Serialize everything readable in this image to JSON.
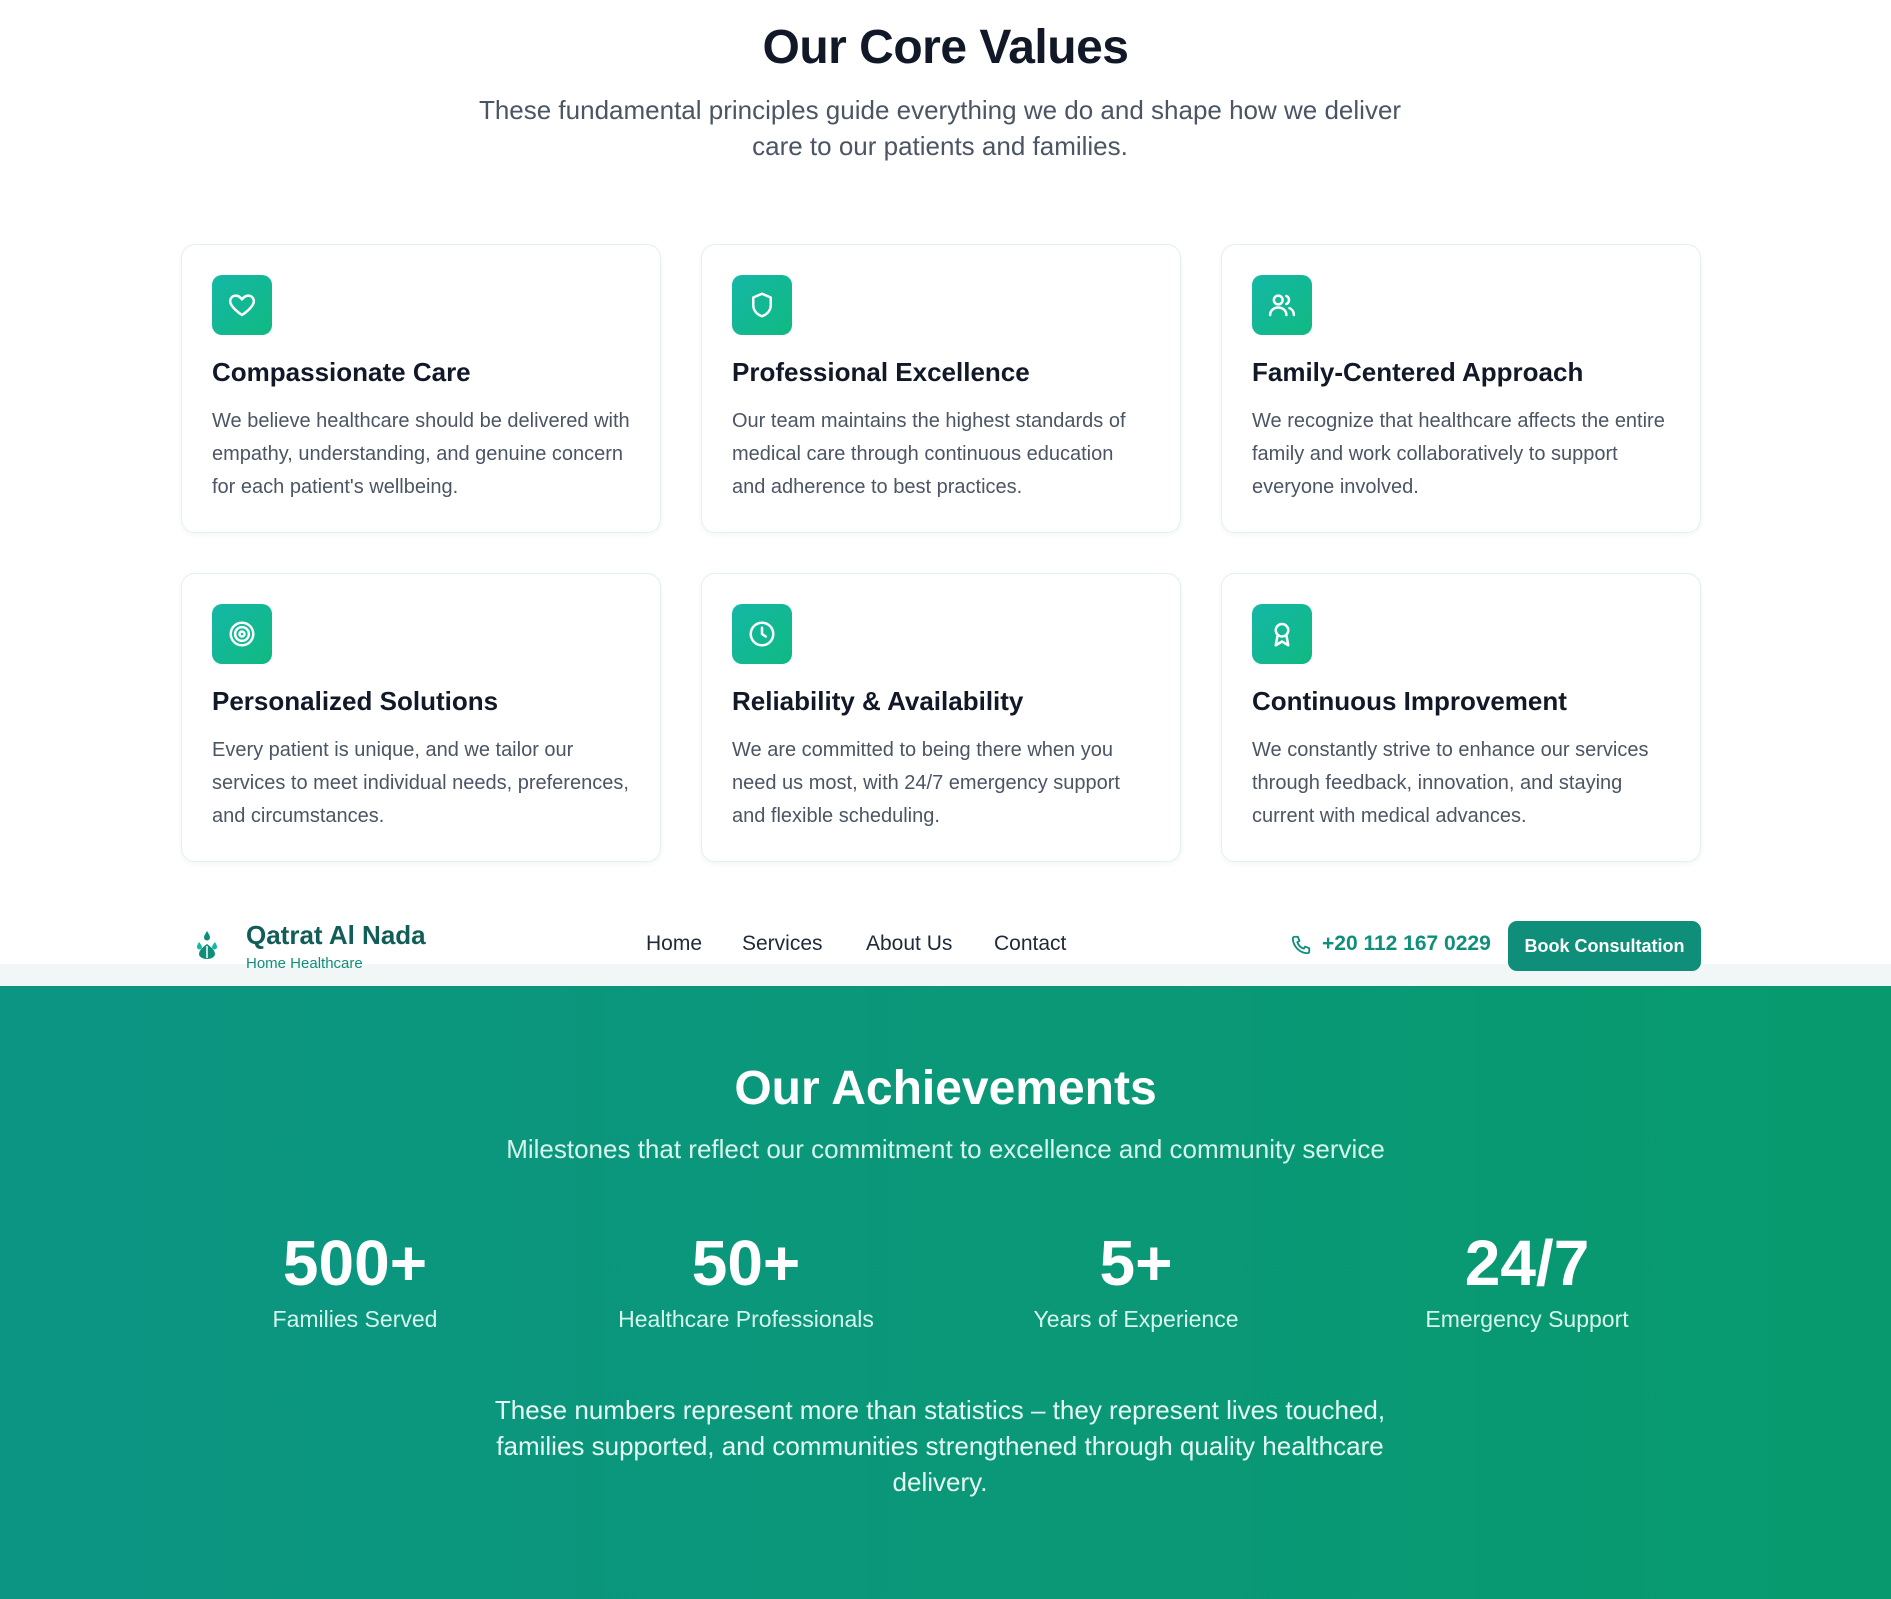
{
  "colors": {
    "brand": "#0f8f7a",
    "brand_dark": "#115e59",
    "icon_gradient_start": "#14b8a6",
    "icon_gradient_end": "#10b981",
    "achievements_bg_start": "#0c9583",
    "achievements_bg_end": "#089a6e"
  },
  "values": {
    "title": "Our Core Values",
    "subtitle": "These fundamental principles guide everything we do and shape how we deliver care to our patients and families.",
    "cards": [
      {
        "icon": "heart-icon",
        "title": "Compassionate Care",
        "text": "We believe healthcare should be delivered with empathy, understanding, and genuine concern for each patient's wellbeing."
      },
      {
        "icon": "shield-icon",
        "title": "Professional Excellence",
        "text": "Our team maintains the highest standards of medical care through continuous education and adherence to best practices."
      },
      {
        "icon": "users-icon",
        "title": "Family-Centered Approach",
        "text": "We recognize that healthcare affects the entire family and work collaboratively to support everyone involved."
      },
      {
        "icon": "target-icon",
        "title": "Personalized Solutions",
        "text": "Every patient is unique, and we tailor our services to meet individual needs, preferences, and circumstances."
      },
      {
        "icon": "clock-icon",
        "title": "Reliability & Availability",
        "text": "We are committed to being there when you need us most, with 24/7 emergency support and flexible scheduling."
      },
      {
        "icon": "award-icon",
        "title": "Continuous Improvement",
        "text": "We constantly strive to enhance our services through feedback, innovation, and staying current with medical advances."
      }
    ]
  },
  "navbar": {
    "brand_name": "Qatrat Al Nada",
    "brand_tagline": "Home Healthcare",
    "links": [
      "Home",
      "Services",
      "About Us",
      "Contact"
    ],
    "phone": "+20 112 167 0229",
    "cta_label": "Book Consultation"
  },
  "achievements": {
    "title": "Our Achievements",
    "subtitle": "Milestones that reflect our commitment to excellence and community service",
    "stats": [
      {
        "value": "500+",
        "label": "Families Served"
      },
      {
        "value": "50+",
        "label": "Healthcare Professionals"
      },
      {
        "value": "5+",
        "label": "Years of Experience"
      },
      {
        "value": "24/7",
        "label": "Emergency Support"
      }
    ],
    "note": "These numbers represent more than statistics – they represent lives touched, families supported, and communities strengthened through quality healthcare delivery."
  }
}
